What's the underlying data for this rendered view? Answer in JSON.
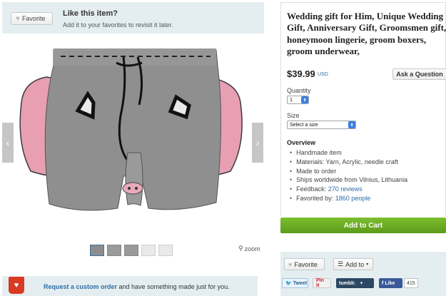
{
  "favorite_banner": {
    "button_label": "Favorite",
    "heading": "Like this item?",
    "subtext": "Add it to your favorites to revisit it later."
  },
  "gallery": {
    "zoom_label": "zoom",
    "thumbnail_count": 5,
    "selected_thumbnail": 1
  },
  "custom_order": {
    "link_text": "Request a custom order",
    "rest_text": " and have something made just for you."
  },
  "listing": {
    "title": "Wedding gift for Him, Unique Wedding Gift, Anniversary Gift, Groomsmen gift, honeymoon lingerie, groom boxers, groom underwear,",
    "price": "$39.99",
    "currency": "USD",
    "ask_button": "Ask a Question",
    "quantity_label": "Quantity",
    "quantity_value": "1",
    "size_label": "Size",
    "size_value": "Select a size",
    "overview_heading": "Overview",
    "overview_items": [
      "Handmade item",
      "Materials: Yarn, Acrylic, needle craft",
      "Made to order",
      "Ships worldwide from Vilnius, Lithuania"
    ],
    "feedback_prefix": "Feedback: ",
    "feedback_link": "270 reviews",
    "favorited_prefix": "Favorited by: ",
    "favorited_link": "1860 people"
  },
  "cart": {
    "label": "Add to Cart"
  },
  "actions": {
    "favorite_label": "Favorite",
    "add_to_label": "Add to",
    "tweet_label": "Tweet",
    "pin_label": "Pin it",
    "tumblr_label": "tumblr.",
    "like_label": "Like",
    "like_count": "415"
  },
  "colors": {
    "banner_bg": "#e4eef1",
    "link": "#2f6ca6",
    "cart_green": "#6aab24",
    "custom_order_red": "#d83b22"
  }
}
